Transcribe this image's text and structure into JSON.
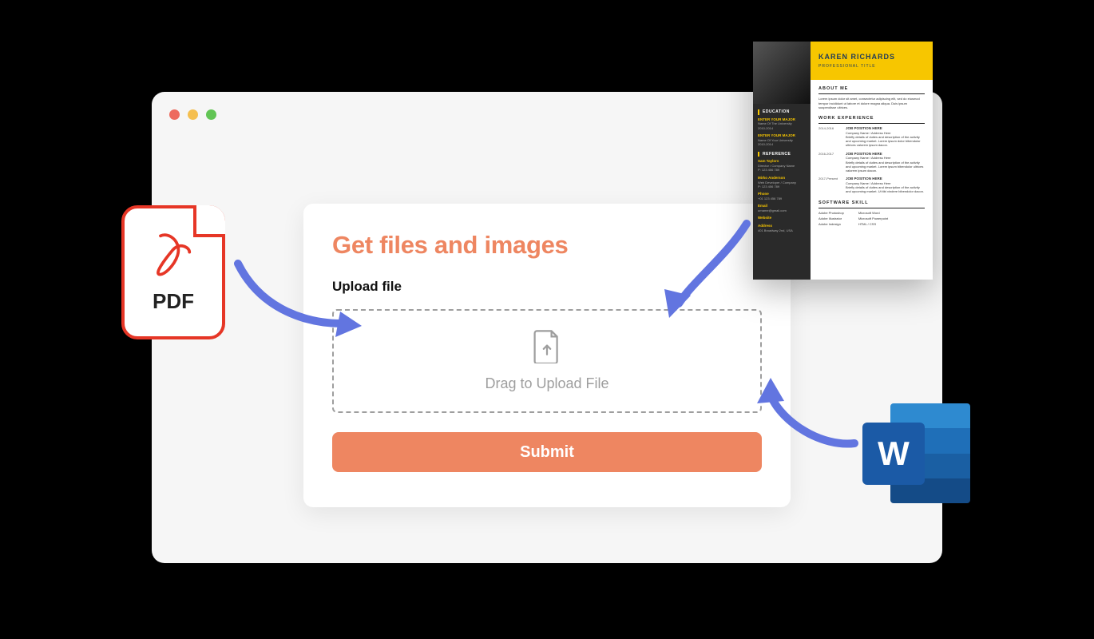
{
  "card": {
    "title": "Get files and images",
    "upload_label": "Upload file",
    "dropzone_text": "Drag to Upload File",
    "submit_label": "Submit"
  },
  "pdf_badge": {
    "label": "PDF"
  },
  "word_badge": {
    "letter": "W"
  },
  "resume": {
    "name": "KAREN RICHARDS",
    "title": "PROFESSIONAL TITLE",
    "sections": {
      "about": "ABOUT ME",
      "work": "WORK EXPERIENCE",
      "skills": "SOFTWARE SKILL",
      "education": "EDUCATION",
      "reference": "REFERENCE"
    },
    "sidebar": {
      "edu1_title": "ENTER YOUR MAJOR",
      "edu1_line": "Name Of The University",
      "edu1_date": "2010-2014",
      "edu2_title": "ENTER YOUR MAJOR",
      "edu2_line": "Name Of Your University",
      "edu2_date": "2010-2014",
      "ref1_name": "Sam Taylors",
      "ref1_role": "Director / Company Name",
      "ref1_phone": "P: 123 456 789",
      "ref2_name": "Mirko Anderson",
      "ref2_role": "Web Developer / Company",
      "ref2_phone": "P: 123 456 789",
      "contact_phone_label": "Phone",
      "contact_phone": "+01 123 456 789",
      "contact_email_label": "Email",
      "contact_email": "urname@gmail.com",
      "contact_web_label": "Website",
      "contact_add_label": "Address",
      "contact_add": "401 Broadway 2nd, USA"
    },
    "about_text": "Lorem ipsum dolor sit amet, consectetur adipiscing elit, sed do eiusmod tempor incididunt ut labore et dolore magna aliqua. Duis ipsum suspendisse ultrices.",
    "work": [
      {
        "dates": "2014-2016",
        "role": "JOB POSITION HERE",
        "company": "Company Name / Address Here",
        "desc": "Briefly details of duties and description of the activity and upcoming market. Lorem ipsum dolor bibendolor ultrices valorem ipsum dacon."
      },
      {
        "dates": "2016-2017",
        "role": "JOB POSITION HERE",
        "company": "Company Name / Address Here",
        "desc": "Briefly details of duties and description of the activity and upcoming market. Lorem ipsum bibendolor ultrices valorem ipsum dacon."
      },
      {
        "dates": "2017-Present",
        "role": "JOB POSITION HERE",
        "company": "Company Name / Address Here",
        "desc": "Briefly details of duties and description of the activity and upcoming market. Ut tibi vindere bibendolor dacon."
      }
    ],
    "skills_left": [
      "Adobe Photoshop",
      "Adobe Illustrator",
      "Adobe Indesign"
    ],
    "skills_right": [
      "Microsoft Word",
      "Microsoft Powerpoint",
      "HTML / CSS"
    ]
  },
  "colors": {
    "accent": "#ee8661",
    "arrow": "#6275e0",
    "pdf_red": "#e63626",
    "word_blue": "#1b5aa6",
    "resume_yellow": "#f7c600"
  }
}
